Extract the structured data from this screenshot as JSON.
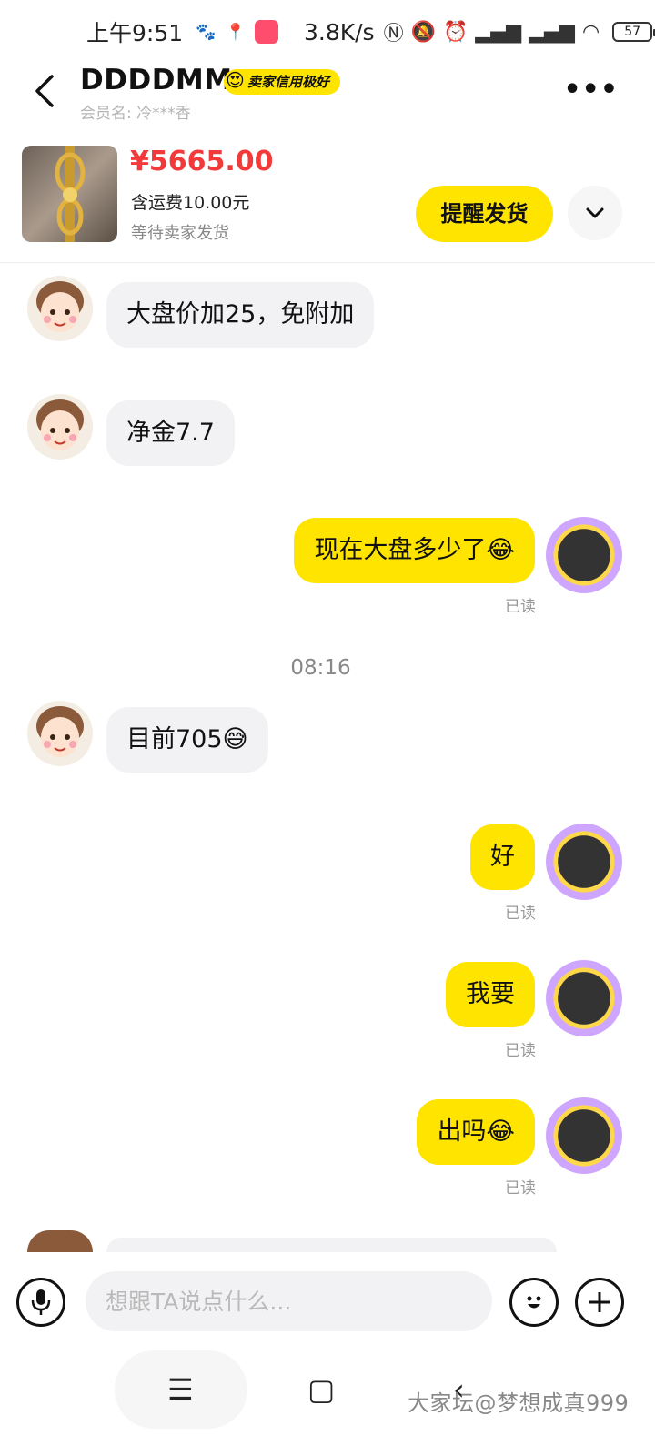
{
  "status_bar": {
    "time": "上午9:51",
    "net_speed": "3.8K/s",
    "battery": "57"
  },
  "header": {
    "seller_name": "DDDDMM",
    "credit_badge": "卖家信用极好",
    "member_label": "会员名: 冷***香"
  },
  "order": {
    "price": "¥5665.00",
    "shipping": "含运费10.00元",
    "status": "等待卖家发货",
    "remind_button": "提醒发货"
  },
  "messages": [
    {
      "side": "left",
      "text": "大盘价加25，免附加"
    },
    {
      "side": "left",
      "text": "净金7.7"
    },
    {
      "side": "right",
      "text": "现在大盘多少了😂",
      "read": "已读"
    },
    {
      "side": "time",
      "text": "08:16"
    },
    {
      "side": "left",
      "text": "目前705😅"
    },
    {
      "side": "right",
      "text": "好",
      "read": "已读"
    },
    {
      "side": "right",
      "text": "我要",
      "read": "已读"
    },
    {
      "side": "right",
      "text": "出吗😂",
      "read": "已读"
    }
  ],
  "input": {
    "placeholder": "想跟TA说点什么..."
  },
  "watermark": "大家坛@梦想成真999",
  "colors": {
    "accent_yellow": "#ffe400",
    "price_red": "#f23a3a",
    "bubble_gray": "#f2f2f4"
  }
}
